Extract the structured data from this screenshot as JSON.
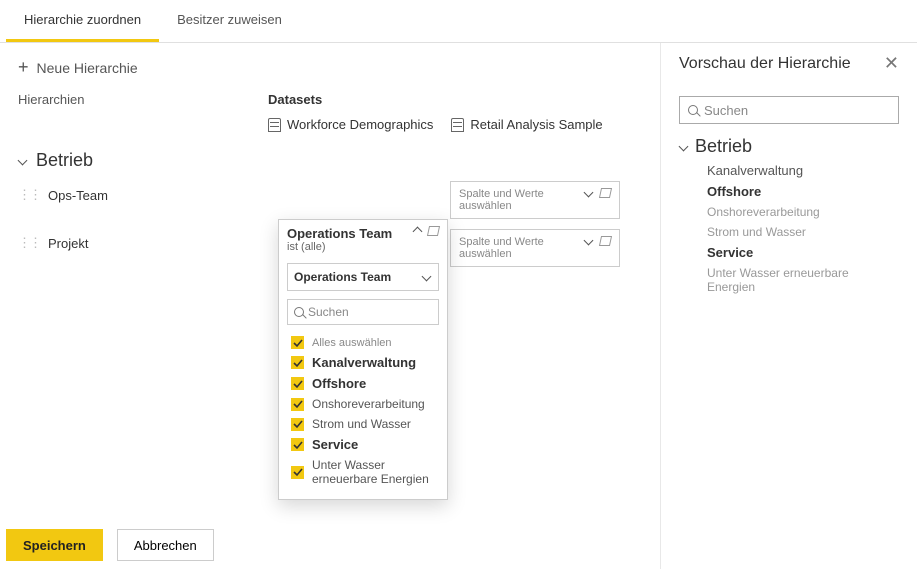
{
  "tabs": {
    "assign": "Hierarchie zuordnen",
    "owners": "Besitzer zuweisen"
  },
  "newHierarchy": "Neue Hierarchie",
  "colHier": "Hierarchien",
  "colDs": "Datasets",
  "datasets": [
    "Workforce Demographics",
    "Retail Analysis Sample"
  ],
  "section": "Betrieb",
  "rows": [
    "Ops-Team",
    "Projekt"
  ],
  "card": {
    "title": "Operations Team",
    "sub": "ist (alle)",
    "ddSelected": "Operations Team",
    "searchPh": "Suchen",
    "opts": {
      "all": "Alles auswählen",
      "o1": "Kanalverwaltung",
      "o2": "Offshore",
      "o3": "Onshoreverarbeitung",
      "o4": "Strom und Wasser",
      "o5": "Service",
      "o6": "Unter Wasser erneuerbare Energien"
    }
  },
  "emptyCard": "Spalte und Werte auswählen",
  "save": "Speichern",
  "cancel": "Abbrechen",
  "preview": {
    "title": "Vorschau der Hierarchie",
    "searchPh": "Suchen",
    "root": "Betrieb",
    "n1": "Kanalverwaltung",
    "n2": "Offshore",
    "n3": "Onshoreverarbeitung",
    "n4": "Strom und Wasser",
    "n5": "Service",
    "n6": "Unter Wasser erneuerbare Energien"
  }
}
